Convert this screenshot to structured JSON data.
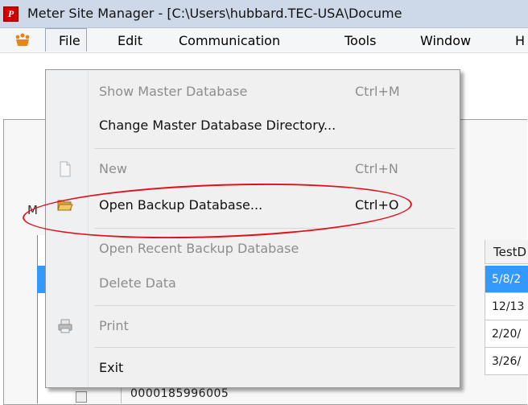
{
  "window": {
    "title": "Meter Site Manager - [C:\\Users\\hubbard.TEC-USA\\Docume",
    "app_icon_letter": "P"
  },
  "menubar": {
    "items": [
      "File",
      "Edit",
      "Communication",
      "Tools",
      "Window",
      "H"
    ]
  },
  "file_menu": {
    "items": [
      {
        "label": "Show Master Database",
        "shortcut": "Ctrl+M",
        "enabled": false,
        "icon": ""
      },
      {
        "label": "Change Master Database Directory...",
        "shortcut": "",
        "enabled": true,
        "icon": ""
      },
      {
        "label": "New",
        "shortcut": "Ctrl+N",
        "enabled": false,
        "icon": "new-document-icon"
      },
      {
        "label": "Open Backup Database...",
        "shortcut": "Ctrl+O",
        "enabled": true,
        "icon": "open-folder-icon",
        "highlighted": true
      },
      {
        "label": "Open Recent Backup Database",
        "shortcut": "",
        "enabled": false,
        "icon": ""
      },
      {
        "label": "Delete Data",
        "shortcut": "",
        "enabled": false,
        "icon": ""
      },
      {
        "label": "Print",
        "shortcut": "",
        "enabled": false,
        "icon": "printer-icon"
      },
      {
        "label": "Exit",
        "shortcut": "",
        "enabled": true,
        "icon": ""
      }
    ]
  },
  "background": {
    "label_fragment": "M",
    "grid": {
      "header": "TestD",
      "cells": [
        "5/8/2",
        "12/13",
        "2/20/",
        "3/26/"
      ],
      "selected_row": 0,
      "bottom_row_text": "0000185996005"
    }
  },
  "colors": {
    "selection": "#3399ff",
    "annotation": "#e0101a",
    "titlebar": "#cdd9e9"
  }
}
